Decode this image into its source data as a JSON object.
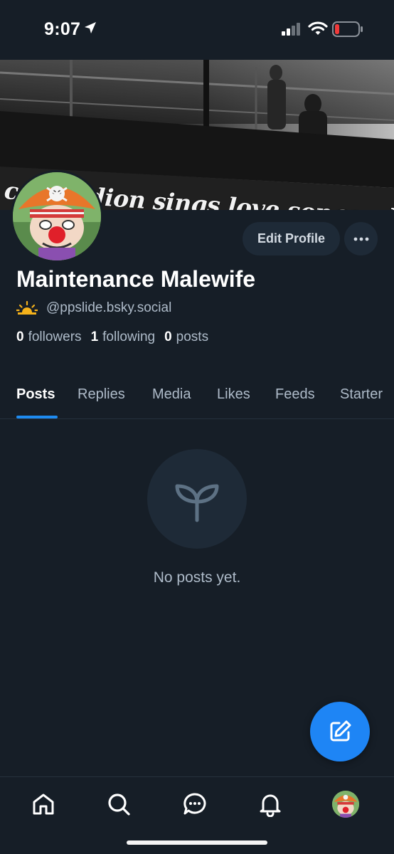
{
  "status_bar": {
    "time": "9:07"
  },
  "banner": {
    "text": "celine dion sings love songs while our cities bu"
  },
  "profile": {
    "display_name": "Maintenance Malewife",
    "handle": "@ppslide.bsky.social",
    "edit_label": "Edit Profile",
    "more_label": "···"
  },
  "stats": {
    "followers_count": "0",
    "followers_label": "followers",
    "following_count": "1",
    "following_label": "following",
    "posts_count": "0",
    "posts_label": "posts"
  },
  "tabs": [
    {
      "label": "Posts",
      "active": true
    },
    {
      "label": "Replies",
      "active": false
    },
    {
      "label": "Media",
      "active": false
    },
    {
      "label": "Likes",
      "active": false
    },
    {
      "label": "Feeds",
      "active": false
    },
    {
      "label": "Starter",
      "active": false
    }
  ],
  "empty_state": {
    "icon": "sprout-icon",
    "text": "No posts yet."
  },
  "fab": {
    "icon": "compose-icon"
  },
  "bottom_nav": [
    {
      "icon": "home-icon"
    },
    {
      "icon": "search-icon"
    },
    {
      "icon": "chat-icon"
    },
    {
      "icon": "bell-icon"
    },
    {
      "icon": "avatar"
    }
  ],
  "colors": {
    "background": "#161e27",
    "accent": "#1e85f5",
    "secondary_text": "#aebbc9",
    "button_bg": "#1e2a37"
  }
}
